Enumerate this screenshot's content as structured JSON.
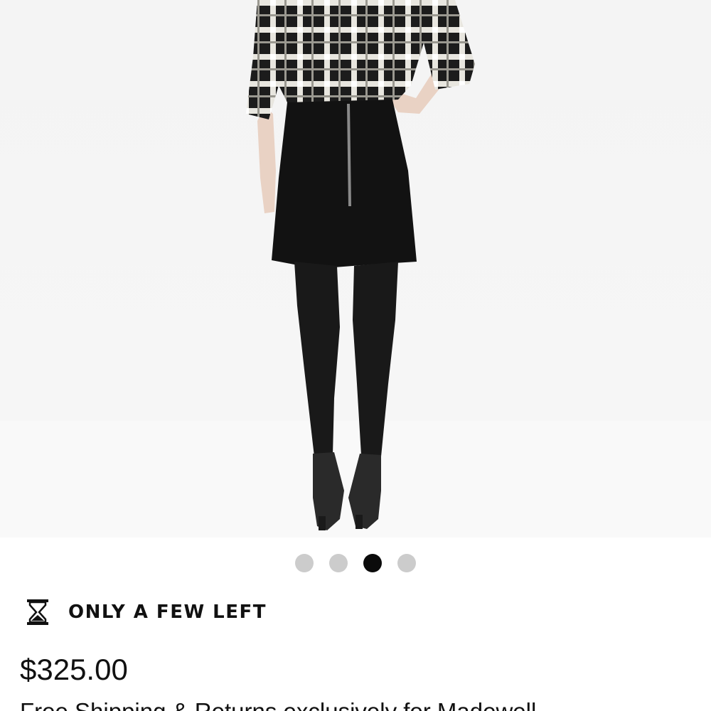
{
  "product": {
    "image_alt": "Model wearing black mini skirt with plaid shirt, rear view",
    "carousel": {
      "total": 4,
      "active_index": 2
    },
    "stock_status": "ONLY A FEW LEFT",
    "stock_icon": "hourglass-icon",
    "price": "$325.00",
    "shipping_note": "Free Shipping & Returns exclusively for Madewell"
  }
}
